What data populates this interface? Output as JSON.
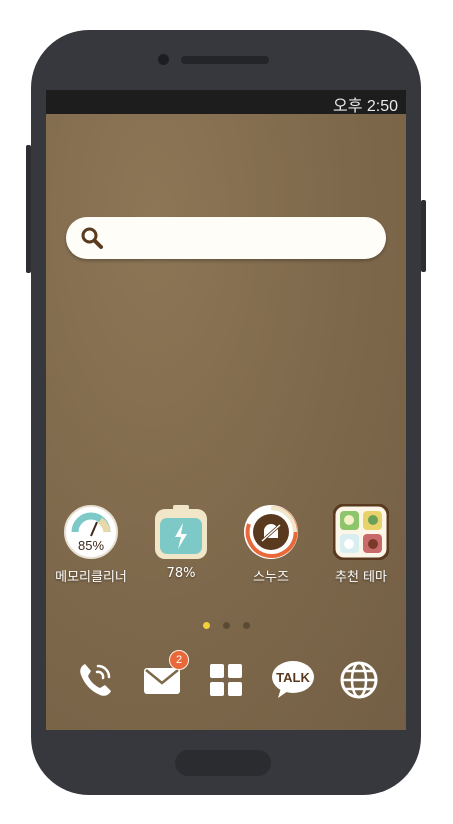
{
  "status_bar": {
    "time": "오후 2:50"
  },
  "search": {
    "placeholder": ""
  },
  "apps": [
    {
      "label": "메모리클리너",
      "value": "85%",
      "icon": "memory-gauge-icon"
    },
    {
      "label": "78%",
      "icon": "battery-icon"
    },
    {
      "label": "스누즈",
      "icon": "snooze-bell-off-icon"
    },
    {
      "label": "추천 테마",
      "icon": "theme-folder-icon"
    }
  ],
  "page_indicator": {
    "pages": 3,
    "current": 1
  },
  "dock": [
    {
      "name": "phone",
      "icon": "phone-icon"
    },
    {
      "name": "messages",
      "icon": "envelope-icon",
      "badge": "2"
    },
    {
      "name": "apps",
      "icon": "app-grid-icon"
    },
    {
      "name": "kakaotalk",
      "icon": "talk-bubble-icon",
      "text": "TALK"
    },
    {
      "name": "browser",
      "icon": "globe-icon"
    }
  ],
  "colors": {
    "wallpaper": "#806a4c",
    "accent_orange": "#e8683a",
    "teal": "#7cc9c7",
    "dot_active": "#f3d13a"
  }
}
